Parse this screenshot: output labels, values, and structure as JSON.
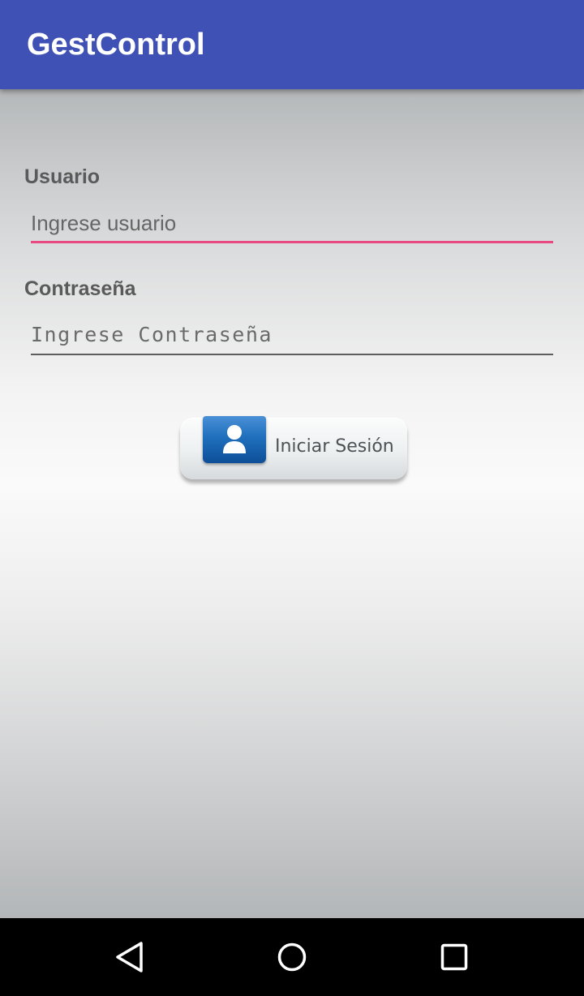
{
  "app_bar": {
    "title": "GestControl",
    "color": "#3f51b5"
  },
  "form": {
    "username": {
      "label": "Usuario",
      "placeholder": "Ingrese usuario",
      "underline_color": "#e8497f"
    },
    "password": {
      "label": "Contraseña",
      "placeholder": "Ingrese Contraseña",
      "underline_color": "#5e5e5e"
    },
    "login_button": {
      "label": "Iniciar Sesión",
      "icon": "user-icon",
      "icon_color": "#1f6fbd"
    }
  },
  "nav_bar": {
    "back_icon": "triangle-back-icon",
    "home_icon": "circle-home-icon",
    "recents_icon": "square-recents-icon"
  }
}
